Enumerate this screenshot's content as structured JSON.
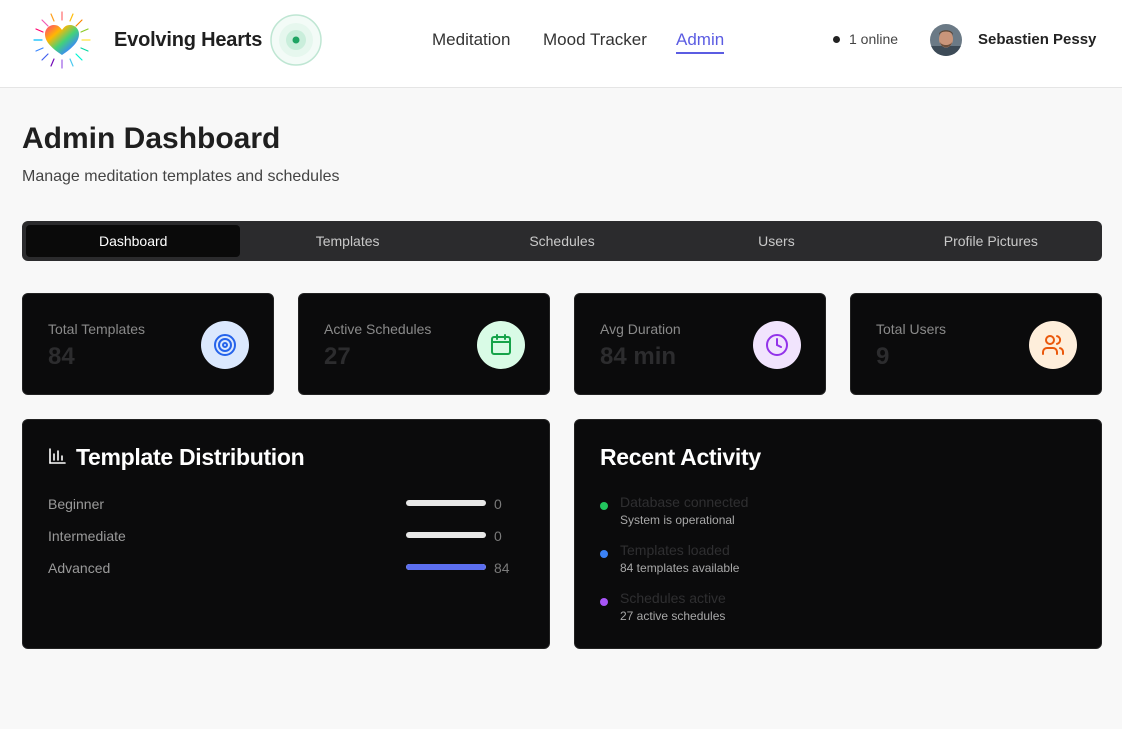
{
  "header": {
    "brand": "Evolving Hearts",
    "nav": [
      "Meditation",
      "Mood Tracker",
      "Admin"
    ],
    "active_nav": "Admin",
    "online": "1 online",
    "user_name": "Sebastien Pessy"
  },
  "page": {
    "title": "Admin Dashboard",
    "subtitle": "Manage meditation templates and schedules"
  },
  "tabs": [
    "Dashboard",
    "Templates",
    "Schedules",
    "Users",
    "Profile Pictures"
  ],
  "active_tab": "Dashboard",
  "stats": [
    {
      "label": "Total Templates",
      "value": "84",
      "icon": "target-icon",
      "bg": "#dbe8fd",
      "color": "#2563eb"
    },
    {
      "label": "Active Schedules",
      "value": "27",
      "icon": "calendar-icon",
      "bg": "#d9fbe6",
      "color": "#16a34a"
    },
    {
      "label": "Avg Duration",
      "value": "84 min",
      "icon": "clock-icon",
      "bg": "#f1e4fd",
      "color": "#9333ea"
    },
    {
      "label": "Total Users",
      "value": "9",
      "icon": "users-icon",
      "bg": "#feeedb",
      "color": "#ea580c"
    }
  ],
  "distribution": {
    "title": "Template Distribution",
    "rows": [
      {
        "label": "Beginner",
        "count": "0",
        "fraction": 0
      },
      {
        "label": "Intermediate",
        "count": "0",
        "fraction": 0
      },
      {
        "label": "Advanced",
        "count": "84",
        "fraction": 1
      }
    ],
    "bar_color": "#5b6ef0"
  },
  "activity": {
    "title": "Recent Activity",
    "items": [
      {
        "title": "Database connected",
        "desc": "System is operational",
        "color": "#22c55e"
      },
      {
        "title": "Templates loaded",
        "desc": "84 templates available",
        "color": "#3b82f6"
      },
      {
        "title": "Schedules active",
        "desc": "27 active schedules",
        "color": "#a855f7"
      }
    ]
  },
  "colors": {
    "accent": "#5b5ce2",
    "panel": "#0b0b0c",
    "tab_bar": "#2b2b2d"
  }
}
